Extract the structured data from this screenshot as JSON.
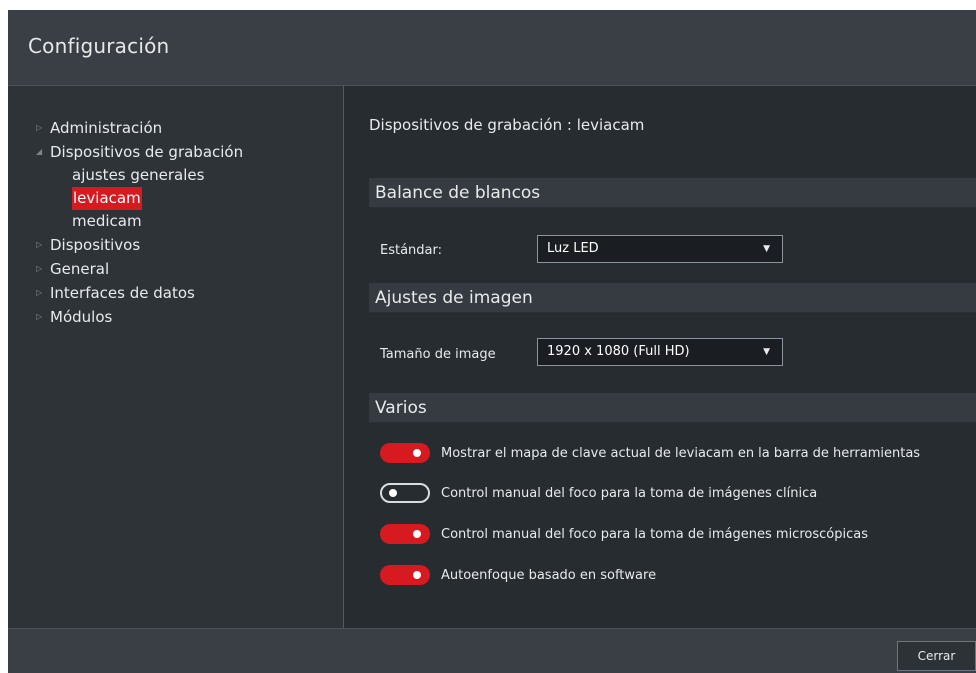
{
  "window": {
    "title": "Configuración"
  },
  "sidebar": {
    "items": [
      {
        "label": "Administración",
        "expanded": false
      },
      {
        "label": "Dispositivos de grabación",
        "expanded": true,
        "children": [
          {
            "label": "ajustes generales",
            "selected": false
          },
          {
            "label": "leviacam",
            "selected": true
          },
          {
            "label": "medicam",
            "selected": false
          }
        ]
      },
      {
        "label": "Dispositivos",
        "expanded": false
      },
      {
        "label": "General",
        "expanded": false
      },
      {
        "label": "Interfaces de datos",
        "expanded": false
      },
      {
        "label": "Módulos",
        "expanded": false
      }
    ]
  },
  "main": {
    "page_title": "Dispositivos de grabación : leviacam",
    "white_balance": {
      "section_label": "Balance de blancos",
      "standard_label": "Estándar:",
      "standard_value": "Luz LED"
    },
    "image_settings": {
      "section_label": "Ajustes de imagen",
      "size_label": "Tamaño de image",
      "size_value": "1920 x 1080 (Full HD)"
    },
    "misc": {
      "section_label": "Varios",
      "toggles": [
        {
          "label": "Mostrar el mapa de clave actual de leviacam en la barra de herramientas",
          "on": true
        },
        {
          "label": "Control manual del foco para la toma de imágenes clínica",
          "on": false
        },
        {
          "label": "Control manual del foco para la toma de imágenes microscópicas",
          "on": true
        },
        {
          "label": "Autoenfoque basado en software",
          "on": true
        }
      ]
    }
  },
  "footer": {
    "close_label": "Cerrar"
  },
  "colors": {
    "accent": "#d71920",
    "background": "#272c31",
    "titlebar": "#3a3f45"
  },
  "icons": {
    "collapsed": "triangle-right-icon",
    "expanded": "triangle-down-icon",
    "dropdown": "caret-down-icon"
  }
}
